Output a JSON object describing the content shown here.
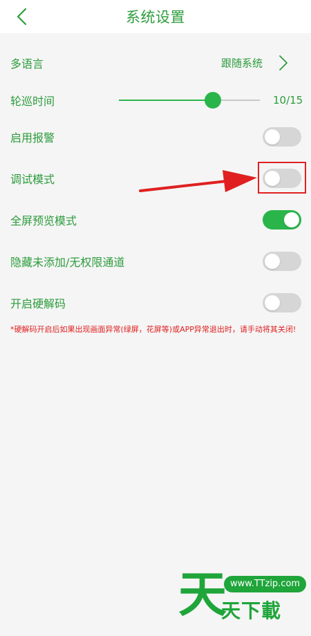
{
  "header": {
    "title": "系统设置",
    "back_icon": "chevron-left-icon"
  },
  "settings": {
    "language": {
      "label": "多语言",
      "value": "跟随系统",
      "icon": "chevron-right-icon"
    },
    "patrol_time": {
      "label": "轮巡时间",
      "value_text": "10/15",
      "value": 10,
      "max": 15
    },
    "enable_alarm": {
      "label": "启用报警",
      "on": false
    },
    "debug_mode": {
      "label": "调试模式",
      "on": false
    },
    "fullscreen_preview": {
      "label": "全屏预览模式",
      "on": true
    },
    "hide_channels": {
      "label": "隐藏未添加/无权限通道",
      "on": false
    },
    "hardware_decode": {
      "label": "开启硬解码",
      "on": false
    }
  },
  "note": "*硬解码开启后如果出现画面异常(绿屏，花屏等)或APP异常退出时，请手动将其关闭!",
  "watermark": {
    "big_char": "天",
    "url": "www.TTzip.com",
    "text": "天下載"
  },
  "colors": {
    "accent": "#2c9c3c",
    "toggle_on": "#2ab54a",
    "toggle_off": "#d6d6d6",
    "annotation": "#e02020"
  }
}
